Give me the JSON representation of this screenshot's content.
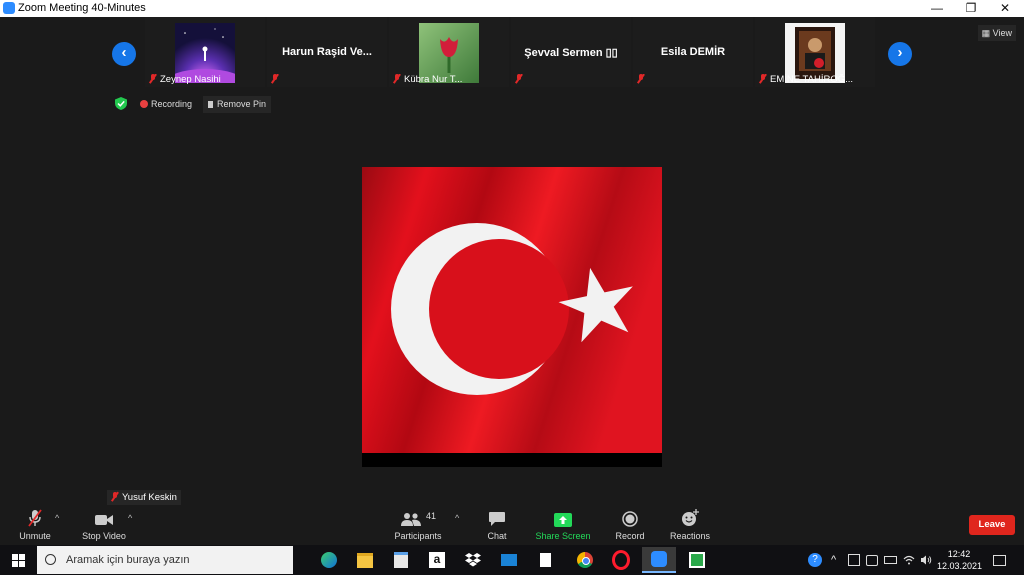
{
  "window": {
    "title": "Zoom Meeting 40-Minutes",
    "minimize": "—",
    "restore": "❐",
    "close": "✕"
  },
  "view_button": {
    "label": "View",
    "icon": "grid-icon"
  },
  "gallery": {
    "prev_icon": "chevron-left-icon",
    "prev_glyph": "‹",
    "next_icon": "chevron-right-icon",
    "next_glyph": "›",
    "participants": [
      {
        "name": "Zeynep Nasihi",
        "display": "thumbnail-image",
        "muted": true
      },
      {
        "name": "Harun  Raşid Ve...",
        "display": "name-only",
        "muted": true
      },
      {
        "name": "Kübra Nur T...",
        "display": "thumbnail-image",
        "muted": true
      },
      {
        "name": "Şevval  Sermen ▯▯",
        "display": "name-only",
        "muted": true
      },
      {
        "name": "Esila DEMİR",
        "display": "name-only",
        "muted": true
      },
      {
        "name": "EMİNE TAHİROĞ...",
        "display": "thumbnail-image",
        "muted": true
      }
    ]
  },
  "status": {
    "recording": "Recording",
    "remove_pin": "Remove Pin"
  },
  "active_speaker": {
    "name": "Yusuf Keskin",
    "muted": true,
    "colors": {
      "flag_red": "#e30a17",
      "white": "#ffffff"
    }
  },
  "toolbar": {
    "unmute": "Unmute",
    "stop_video": "Stop Video",
    "participants": "Participants",
    "participants_count": "41",
    "chat": "Chat",
    "share_screen": "Share Screen",
    "record": "Record",
    "reactions": "Reactions",
    "leave": "Leave",
    "share_color": "#23d959",
    "leave_color": "#e0261d"
  },
  "taskbar": {
    "search_placeholder": "Aramak için buraya yazın",
    "apps": [
      "edge-icon",
      "file-explorer-icon",
      "store-icon",
      "amazon-icon",
      "dropbox-icon",
      "mail-icon",
      "blank-file-icon",
      "chrome-icon",
      "opera-icon",
      "zoom-icon",
      "green-app-icon"
    ],
    "amazon_glyph": "a",
    "tray_help": "?",
    "tray_up": "^",
    "time": "12:42",
    "date": "12.03.2021"
  }
}
